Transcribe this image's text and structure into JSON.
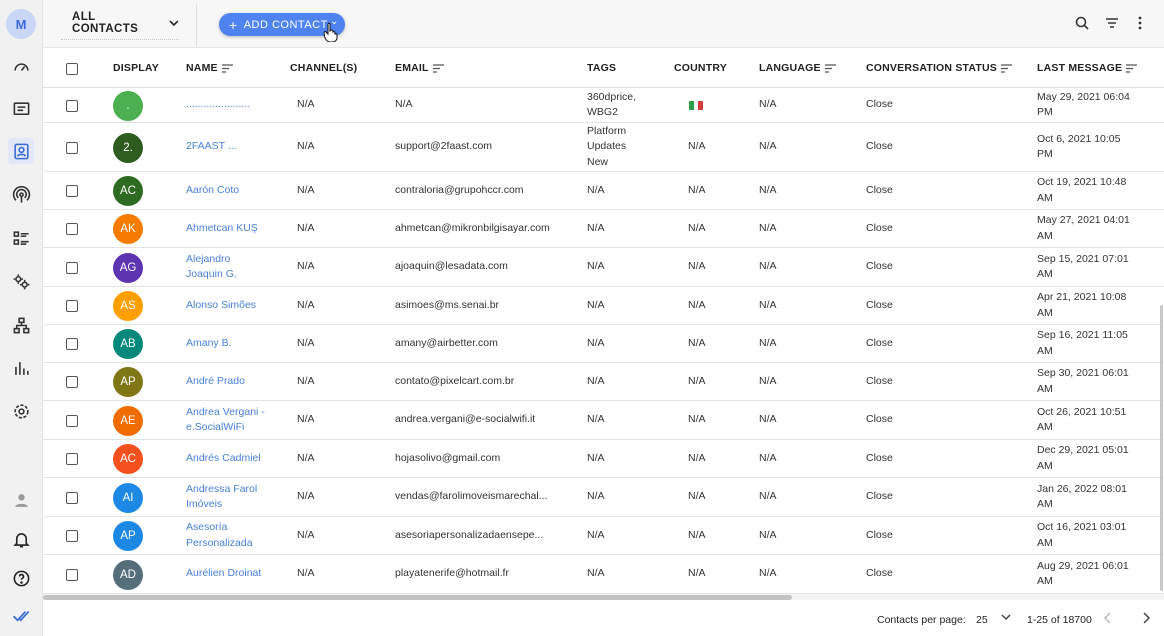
{
  "sidebar": {
    "avatar_initial": "M",
    "icons": [
      "speedometer-icon",
      "chat-icon",
      "contacts-icon",
      "broadcast-icon",
      "list-icon",
      "gears-icon",
      "flow-icon",
      "analytics-icon",
      "settings-icon",
      "user-icon",
      "bell-icon",
      "help-icon",
      "double-check-icon"
    ]
  },
  "topbar": {
    "filter_label": "ALL CONTACTS",
    "add_label": "ADD CONTACT",
    "icons": [
      "search-icon",
      "filter-icon",
      "more-vert-icon"
    ]
  },
  "columns": {
    "display": "DISPLAY",
    "name": "NAME",
    "channels": "CHANNEL(S)",
    "email": "EMAIL",
    "tags": "TAGS",
    "country": "COUNTRY",
    "language": "LANGUAGE",
    "status": "CONVERSATION STATUS",
    "last_message": "LAST MESSAGE"
  },
  "rows": [
    {
      "initials": ".",
      "color": "#4caf50",
      "name": "......................",
      "channels": "N/A",
      "email": "N/A",
      "tags": "360dprice, WBG2",
      "country": "flag-it",
      "language": "N/A",
      "status": "Close",
      "last_message": "May 29, 2021 06:04 PM"
    },
    {
      "initials": "2.",
      "color": "#2e5b1f",
      "name": "2FAAST ...",
      "channels": "N/A",
      "email": "support@2faast.com",
      "tags": "Platform Updates New",
      "country": "N/A",
      "language": "N/A",
      "status": "Close",
      "last_message": "Oct 6, 2021 10:05 PM"
    },
    {
      "initials": "AC",
      "color": "#2e6b22",
      "name": "Aarón Coto",
      "channels": "N/A",
      "email": "contraloria@grupohccr.com",
      "tags": "N/A",
      "country": "N/A",
      "language": "N/A",
      "status": "Close",
      "last_message": "Oct 19, 2021 10:48 AM"
    },
    {
      "initials": "AK",
      "color": "#f57c00",
      "name": "Ahmetcan KUŞ",
      "channels": "N/A",
      "email": "ahmetcan@mikronbilgisayar.com",
      "tags": "N/A",
      "country": "N/A",
      "language": "N/A",
      "status": "Close",
      "last_message": "May 27, 2021 04:01 AM"
    },
    {
      "initials": "AG",
      "color": "#5e35b1",
      "name": "Alejandro Joaquin G.",
      "channels": "N/A",
      "email": "ajoaquin@lesadata.com",
      "tags": "N/A",
      "country": "N/A",
      "language": "N/A",
      "status": "Close",
      "last_message": "Sep 15, 2021 07:01 AM"
    },
    {
      "initials": "AS",
      "color": "#ffa000",
      "name": "Alonso Simões",
      "channels": "N/A",
      "email": "asimoes@ms.senai.br",
      "tags": "N/A",
      "country": "N/A",
      "language": "N/A",
      "status": "Close",
      "last_message": "Apr 21, 2021 10:08 AM"
    },
    {
      "initials": "AB",
      "color": "#00897b",
      "name": "Amany B.",
      "channels": "N/A",
      "email": "amany@airbetter.com",
      "tags": "N/A",
      "country": "N/A",
      "language": "N/A",
      "status": "Close",
      "last_message": "Sep 16, 2021 11:05 AM"
    },
    {
      "initials": "AP",
      "color": "#827717",
      "name": "André Prado",
      "channels": "N/A",
      "email": "contato@pixelcart.com.br",
      "tags": "N/A",
      "country": "N/A",
      "language": "N/A",
      "status": "Close",
      "last_message": "Sep 30, 2021 06:01 AM"
    },
    {
      "initials": "AE",
      "color": "#ef6c00",
      "name": "Andrea Vergani - e.SocialWiFi",
      "channels": "N/A",
      "email": "andrea.vergani@e-socialwifi.it",
      "tags": "N/A",
      "country": "N/A",
      "language": "N/A",
      "status": "Close",
      "last_message": "Oct 26, 2021 10:51 AM"
    },
    {
      "initials": "AC",
      "color": "#f4511e",
      "name": "Andrés Cadmiel",
      "channels": "N/A",
      "email": "hojasolivo@gmail.com",
      "tags": "N/A",
      "country": "N/A",
      "language": "N/A",
      "status": "Close",
      "last_message": "Dec 29, 2021 05:01 AM"
    },
    {
      "initials": "AI",
      "color": "#1e88e5",
      "name": "Andressa Farol Imóveis",
      "channels": "N/A",
      "email": "vendas@farolimoveismarechal...",
      "tags": "N/A",
      "country": "N/A",
      "language": "N/A",
      "status": "Close",
      "last_message": "Jan 26, 2022 08:01 AM"
    },
    {
      "initials": "AP",
      "color": "#1e88e5",
      "name": "Asesoría Personalizada",
      "channels": "N/A",
      "email": "asesoriapersonalizadaensepe...",
      "tags": "N/A",
      "country": "N/A",
      "language": "N/A",
      "status": "Close",
      "last_message": "Oct 16, 2021 03:01 AM"
    },
    {
      "initials": "AD",
      "color": "#546e7a",
      "name": "Aurélien Droinat",
      "channels": "N/A",
      "email": "playatenerife@hotmail.fr",
      "tags": "N/A",
      "country": "N/A",
      "language": "N/A",
      "status": "Close",
      "last_message": "Aug 29, 2021 06:01 AM"
    }
  ],
  "footer": {
    "per_page_label": "Contacts per page:",
    "per_page_value": "25",
    "range": "1-25 of 18700"
  }
}
